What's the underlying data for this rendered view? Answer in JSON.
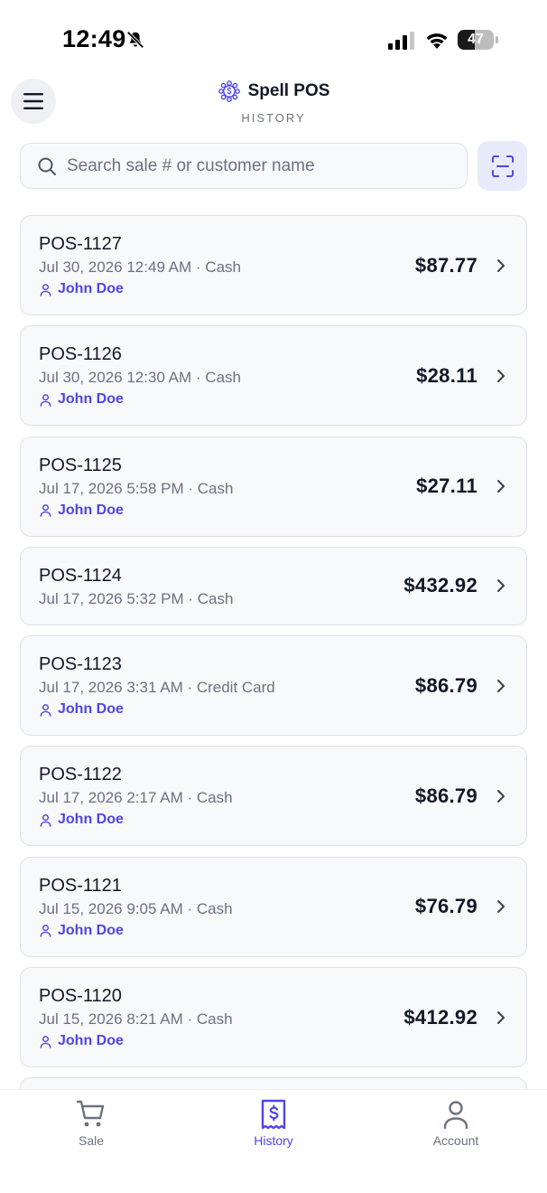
{
  "status_bar": {
    "time": "12:49",
    "battery": "47",
    "battery_level": 0.47
  },
  "header": {
    "app_name": "Spell POS",
    "section": "HISTORY"
  },
  "search": {
    "placeholder": "Search sale # or customer name",
    "value": ""
  },
  "sales": [
    {
      "id": "POS-1127",
      "meta": "Jul 30, 2026 12:49 AM · Cash",
      "customer": "John Doe",
      "amount": "$87.77"
    },
    {
      "id": "POS-1126",
      "meta": "Jul 30, 2026 12:30 AM · Cash",
      "customer": "John Doe",
      "amount": "$28.11"
    },
    {
      "id": "POS-1125",
      "meta": "Jul 17, 2026 5:58 PM · Cash",
      "customer": "John Doe",
      "amount": "$27.11"
    },
    {
      "id": "POS-1124",
      "meta": "Jul 17, 2026 5:32 PM · Cash",
      "customer": "",
      "amount": "$432.92"
    },
    {
      "id": "POS-1123",
      "meta": "Jul 17, 2026 3:31 AM · Credit Card",
      "customer": "John Doe",
      "amount": "$86.79"
    },
    {
      "id": "POS-1122",
      "meta": "Jul 17, 2026 2:17 AM · Cash",
      "customer": "John Doe",
      "amount": "$86.79"
    },
    {
      "id": "POS-1121",
      "meta": "Jul 15, 2026 9:05 AM · Cash",
      "customer": "John Doe",
      "amount": "$76.79"
    },
    {
      "id": "POS-1120",
      "meta": "Jul 15, 2026 8:21 AM · Cash",
      "customer": "John Doe",
      "amount": "$412.92"
    },
    {
      "id": "",
      "meta": "",
      "customer": "",
      "amount": ""
    }
  ],
  "tabs": [
    {
      "label": "Sale",
      "icon": "cart-icon",
      "active": false
    },
    {
      "label": "History",
      "icon": "receipt-icon",
      "active": true
    },
    {
      "label": "Account",
      "icon": "person-icon",
      "active": false
    }
  ],
  "colors": {
    "accent": "#4f46e5",
    "text": "#111827",
    "muted": "#6b7280",
    "card_bg": "#f8f9fb",
    "card_border": "#dde1e8"
  }
}
